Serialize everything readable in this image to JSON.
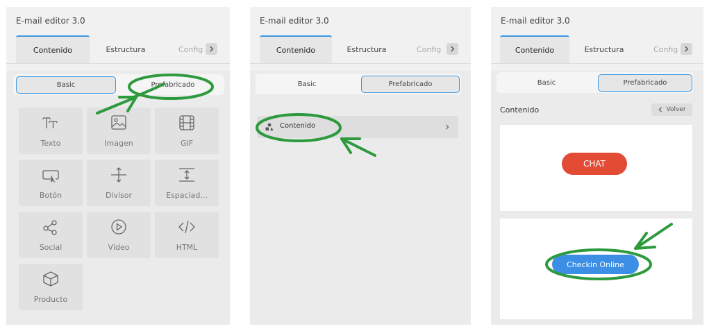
{
  "app_title": "E-mail editor 3.0",
  "tabs": {
    "contenido": "Contenido",
    "estructura": "Estructura",
    "config_truncated": "Config"
  },
  "mode_toggle": {
    "basic": "Basic",
    "prefabricado": "Prefabricado"
  },
  "blocks": [
    {
      "label": "Texto",
      "icon": "text-icon"
    },
    {
      "label": "Imagen",
      "icon": "image-icon"
    },
    {
      "label": "GIF",
      "icon": "film-icon"
    },
    {
      "label": "Botón",
      "icon": "button-cursor-icon"
    },
    {
      "label": "Divisor",
      "icon": "divider-icon"
    },
    {
      "label": "Espaciad...",
      "icon": "spacer-icon"
    },
    {
      "label": "Social",
      "icon": "share-icon"
    },
    {
      "label": "Vídeo",
      "icon": "play-circle-icon"
    },
    {
      "label": "HTML",
      "icon": "code-icon"
    },
    {
      "label": "Producto",
      "icon": "box-icon"
    }
  ],
  "prefab_category": {
    "label": "Contenido"
  },
  "prefab_detail": {
    "section_title": "Contenido",
    "back_label": "Volver",
    "chat_button": "CHAT",
    "checkin_button": "Checkin Online"
  },
  "colors": {
    "accent_blue": "#3d97e0",
    "chat_red": "#e34b34",
    "checkin_blue": "#3d8fe6",
    "annotation_green": "#2e9a3e"
  }
}
